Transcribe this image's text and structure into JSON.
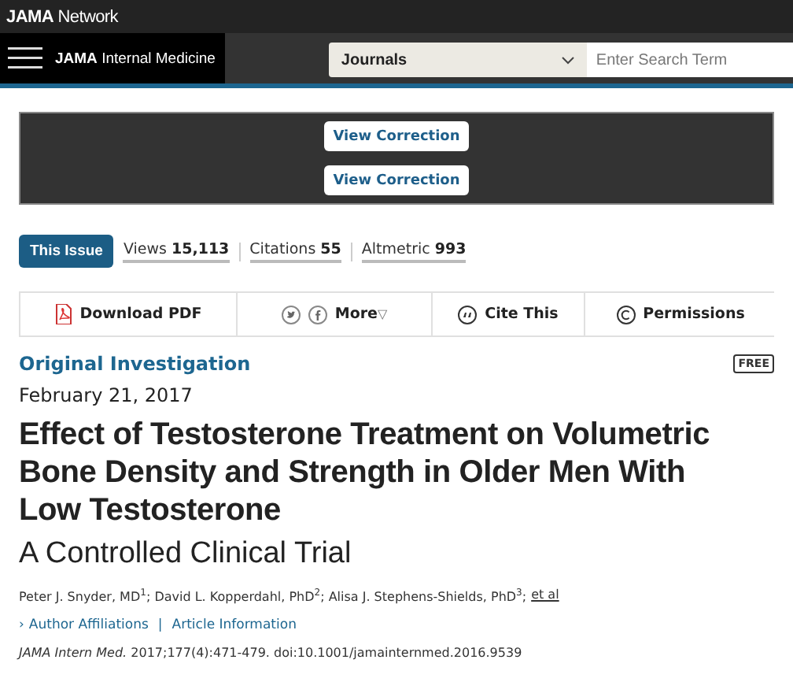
{
  "network_bar": {
    "logo_bold": "JAMA",
    "logo_rest": "Network"
  },
  "nav": {
    "journal_bold": "JAMA",
    "journal_rest": "Internal Medicine",
    "dropdown": "Journals",
    "search": {
      "placeholder": "Enter Search Term"
    }
  },
  "banner": {
    "buttons": [
      "View Correction",
      "View Correction"
    ]
  },
  "issue_button": "This Issue",
  "metrics": [
    {
      "label": "Views",
      "value": "15,113"
    },
    {
      "label": "Citations",
      "value": "55"
    },
    {
      "label": "Altmetric",
      "value": "993"
    }
  ],
  "toolbar": [
    {
      "kind": "pdf",
      "label": "Download PDF"
    },
    {
      "kind": "share",
      "label": "More",
      "caret": "▽"
    },
    {
      "kind": "cite",
      "label": "Cite This"
    },
    {
      "kind": "permissions",
      "label": "Permissions"
    }
  ],
  "article": {
    "type": "Original Investigation",
    "badge": "FREE",
    "date": "February 21, 2017",
    "title": "Effect of Testosterone Treatment on Volumetric Bone Density and Strength in Older Men With Low Testosterone",
    "subtitle": "A Controlled Clinical Trial",
    "authors": "Peter J. Snyder, MD$^{1}$; David L. Kopperdahl, PhD$^{2}$; Alisa J. Stephens-Shields, PhD$^{3}$;",
    "authors_more": "et al",
    "links": [
      {
        "label": "Author Affiliations",
        "caret": "›"
      },
      {
        "label": "Article Information"
      }
    ],
    "links_separator": "|",
    "citation": "*JAMA Intern Med.* 2017;177(4):471-479. doi:10.1001/jamainternmed.2016.9539"
  }
}
